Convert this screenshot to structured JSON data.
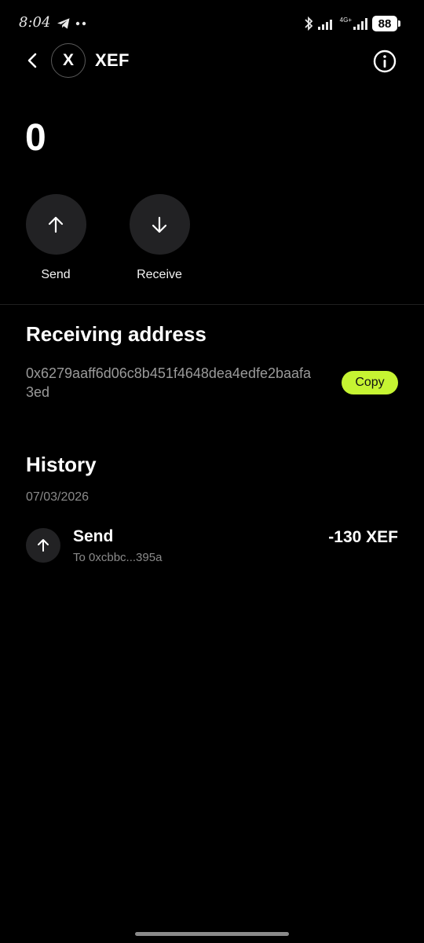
{
  "status_bar": {
    "time": "8:04",
    "network": "4G+",
    "battery": "88",
    "icons": [
      "telegram-icon",
      "more-dots-icon",
      "bluetooth-icon",
      "signal-icon",
      "signal-4g-icon"
    ]
  },
  "header": {
    "token_symbol_logo": "X",
    "token_name": "XEF",
    "icons": [
      "back-arrow-icon",
      "info-icon"
    ]
  },
  "balance": "0",
  "actions": {
    "send_label": "Send",
    "receive_label": "Receive"
  },
  "receiving": {
    "title": "Receiving address",
    "address": "0x6279aaff6d06c8b451f4648dea4edfe2baafa3ed",
    "copy_label": "Copy"
  },
  "history": {
    "title": "History",
    "groups": [
      {
        "date": "07/03/2026",
        "items": [
          {
            "type": "Send",
            "to": "To 0xcbbc...395a",
            "amount": "-130 XEF"
          }
        ]
      }
    ]
  },
  "colors": {
    "background": "#000000",
    "accent": "#c6f432",
    "button_bg": "#222224",
    "secondary_text": "#9a9a9a"
  }
}
